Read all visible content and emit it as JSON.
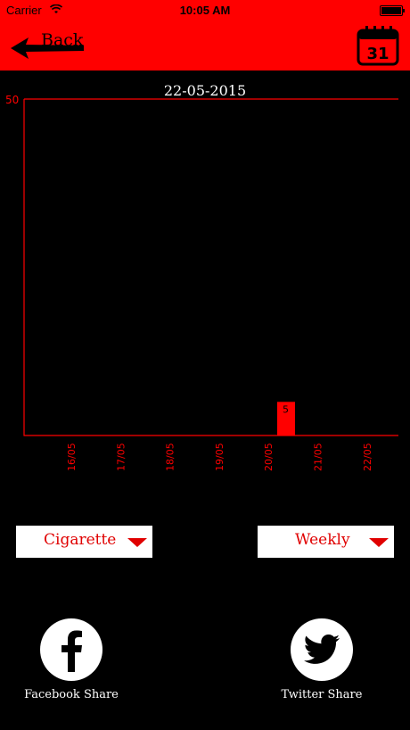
{
  "status_bar": {
    "carrier": "Carrier",
    "time": "10:05 AM",
    "wifi_icon": "wifi-icon",
    "battery_icon": "battery-icon"
  },
  "nav": {
    "back_label": "Back",
    "back_icon": "back-arrow-icon",
    "calendar_icon": "calendar-icon",
    "calendar_day": "31",
    "background": "#ff0000"
  },
  "chart_title": "22-05-2015",
  "chart_data": {
    "type": "bar",
    "title": "22-05-2015",
    "categories": [
      "16/05",
      "17/05",
      "18/05",
      "19/05",
      "20/05",
      "21/05",
      "22/05"
    ],
    "values": [
      0,
      0,
      0,
      0,
      0,
      0,
      5
    ],
    "value_labels": [
      "",
      "",
      "",
      "",
      "",
      "",
      "5"
    ],
    "ymax_label": "50",
    "ylim": [
      0,
      50
    ],
    "bar_color": "#ff0000",
    "axis_color": "#ff0000"
  },
  "controls": {
    "product_select": "Cigarette",
    "period_select": "Weekly"
  },
  "share": {
    "facebook_label": "Facebook Share",
    "facebook_icon": "facebook-icon",
    "twitter_label": "Twitter Share",
    "twitter_icon": "twitter-icon"
  }
}
